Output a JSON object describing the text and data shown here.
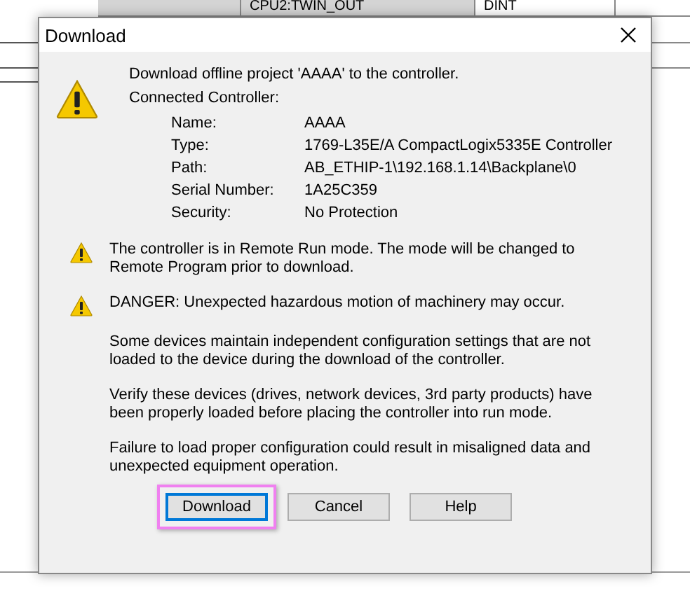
{
  "background_table": {
    "cells": [
      "CPU2:TWIN_OUT",
      "DINT"
    ]
  },
  "dialog": {
    "title": "Download",
    "intro": "Download offline project 'AAAA' to the controller.",
    "connected_label": "Connected Controller:",
    "details": [
      {
        "label": "Name:",
        "value": "AAAA"
      },
      {
        "label": "Type:",
        "value": "1769-L35E/A CompactLogix5335E Controller"
      },
      {
        "label": "Path:",
        "value": "AB_ETHIP-1\\192.168.1.14\\Backplane\\0"
      },
      {
        "label": "Serial Number:",
        "value": "1A25C359"
      },
      {
        "label": "Security:",
        "value": "No Protection"
      }
    ],
    "messages": [
      {
        "kind": "warning",
        "text": "The controller is in Remote Run mode. The mode will be changed to Remote Program prior to download."
      },
      {
        "kind": "warning",
        "text": "DANGER: Unexpected hazardous motion of machinery may occur."
      },
      {
        "kind": "plain",
        "text": "Some devices maintain independent configuration settings that are not loaded to the device during the download of the controller."
      },
      {
        "kind": "plain",
        "text": "Verify these devices (drives, network devices, 3rd party products) have been properly loaded before placing the controller into run mode."
      },
      {
        "kind": "plain",
        "text": "Failure to load proper configuration could result in misaligned data and unexpected equipment operation."
      }
    ],
    "buttons": [
      {
        "label": "Download",
        "default": true,
        "highlighted": true
      },
      {
        "label": "Cancel",
        "default": false,
        "highlighted": false
      },
      {
        "label": "Help",
        "default": false,
        "highlighted": false
      }
    ]
  }
}
